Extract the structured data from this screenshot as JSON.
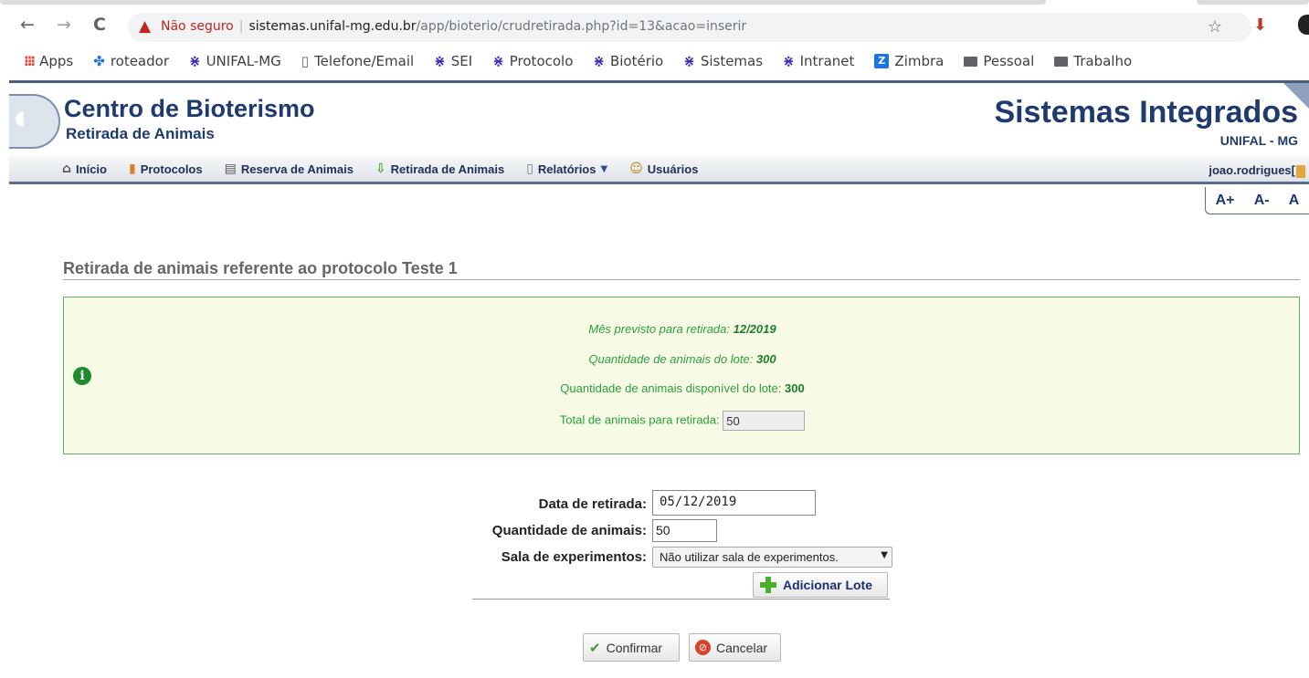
{
  "browser": {
    "back": "←",
    "forward": "→",
    "reload": "C",
    "warning_icon": "warning-icon",
    "insecure_label": "Não seguro",
    "url_host": "sistemas.unifal-mg.edu.br",
    "url_path": "/app/bioterio/crudretirada.php?id=13&acao=inserir",
    "star": "☆"
  },
  "bookmarks": [
    {
      "label": "Apps",
      "icon": "apps-grid-icon"
    },
    {
      "label": "roteador",
      "icon": "router-icon"
    },
    {
      "label": "UNIFAL-MG",
      "icon": "unifal-icon"
    },
    {
      "label": "Telefone/Email",
      "icon": "page-icon"
    },
    {
      "label": "SEI",
      "icon": "unifal-icon"
    },
    {
      "label": "Protocolo",
      "icon": "unifal-icon"
    },
    {
      "label": "Biotério",
      "icon": "unifal-icon"
    },
    {
      "label": "Sistemas",
      "icon": "unifal-icon"
    },
    {
      "label": "Intranet",
      "icon": "unifal-icon"
    },
    {
      "label": "Zimbra",
      "icon": "zimbra-icon"
    },
    {
      "label": "Pessoal",
      "icon": "folder-icon"
    },
    {
      "label": "Trabalho",
      "icon": "folder-icon"
    }
  ],
  "header": {
    "title": "Centro de Bioterismo",
    "subtitle": "Retirada de Animais",
    "system_title": "Sistemas Integrados",
    "system_subtitle": "UNIFAL - MG"
  },
  "menu": {
    "items": [
      {
        "label": "Início",
        "icon": "home-icon"
      },
      {
        "label": "Protocolos",
        "icon": "protocol-icon"
      },
      {
        "label": "Reserva de Animais",
        "icon": "calendar-icon"
      },
      {
        "label": "Retirada de Animais",
        "icon": "down-arrow-icon"
      },
      {
        "label": "Relatórios",
        "icon": "report-icon"
      },
      {
        "label": "Usuários",
        "icon": "users-icon"
      }
    ],
    "user": "joao.rodrigues["
  },
  "font_tools": {
    "increase": "A+",
    "decrease": "A-",
    "reset": "A"
  },
  "main": {
    "heading": "Retirada de animais referente ao protocolo Teste 1",
    "info": {
      "month_label": "Mês previsto para retirada: ",
      "month_value": "12/2019",
      "lot_qty_label": "Quantidade de animais do lote: ",
      "lot_qty_value": "300",
      "available_label": "Quantidade de animais disponível do lote: ",
      "available_value": "300",
      "total_label": "Total de animais para retirada: ",
      "total_value": "50"
    },
    "form": {
      "date_label": "Data de retirada:",
      "date_value": "05/12/2019",
      "qty_label": "Quantidade de animais:",
      "qty_value": "50",
      "room_label": "Sala de experimentos:",
      "room_value": "Não utilizar sala de experimentos.",
      "add_lot": "Adicionar Lote",
      "confirm": "Confirmar",
      "cancel": "Cancelar"
    }
  },
  "colors": {
    "brand": "#1f3a6e",
    "info_bg": "#f7fbe6",
    "info_text": "#2c9d3a"
  }
}
